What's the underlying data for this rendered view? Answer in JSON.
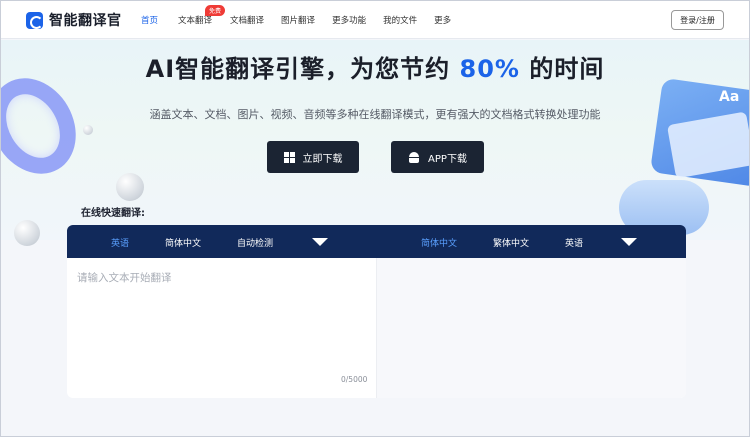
{
  "header": {
    "logo_text": "智能翻译官",
    "nav": [
      {
        "label": "首页",
        "active": true
      },
      {
        "label": "文本翻译",
        "badge": "免费"
      },
      {
        "label": "文档翻译"
      },
      {
        "label": "图片翻译"
      },
      {
        "label": "更多功能"
      },
      {
        "label": "我的文件"
      },
      {
        "label": "更多"
      }
    ],
    "login_label": "登录/注册"
  },
  "hero": {
    "title_prefix": "AI智能翻译引擎，为您节约 ",
    "title_highlight": "80%",
    "title_suffix": " 的时间",
    "subtitle": "涵盖文本、文档、图片、视频、音频等多种在线翻译模式，更有强大的文档格式转换处理功能",
    "download_button": "立即下载",
    "app_button": "APP下载",
    "accent_color": "#1b63e8"
  },
  "translator": {
    "section_label": "在线快速翻译:",
    "source_langs": [
      "英语",
      "简体中文",
      "自动检测"
    ],
    "target_langs": [
      "简体中文",
      "繁体中文",
      "英语"
    ],
    "input_placeholder": "请输入文本开始翻译",
    "char_counter": "0/5000",
    "bar_color": "#11295a"
  }
}
